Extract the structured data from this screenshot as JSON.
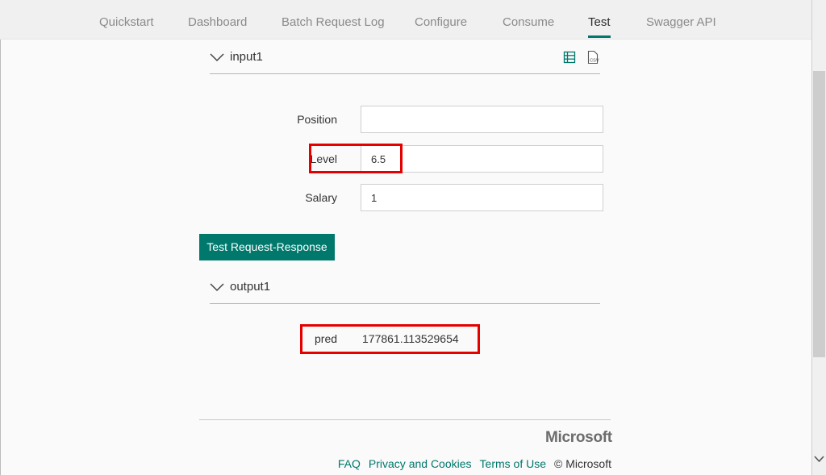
{
  "nav": {
    "tabs": [
      {
        "label": "Quickstart",
        "active": false
      },
      {
        "label": "Dashboard",
        "active": false
      },
      {
        "label": "Batch Request Log",
        "active": false
      },
      {
        "label": "Configure",
        "active": false
      },
      {
        "label": "Consume",
        "active": false
      },
      {
        "label": "Test",
        "active": true
      },
      {
        "label": "Swagger API",
        "active": false
      }
    ]
  },
  "input_section": {
    "title": "input1",
    "icons": [
      "table-view-icon",
      "csv-file-icon"
    ],
    "fields": [
      {
        "label": "Position",
        "value": ""
      },
      {
        "label": "Level",
        "value": "6.5"
      },
      {
        "label": "Salary",
        "value": "1"
      }
    ]
  },
  "test_button": {
    "label": "Test Request-Response"
  },
  "output_section": {
    "title": "output1",
    "result_label": "pred",
    "result_value": "177861.113529654"
  },
  "footer": {
    "brand": "Microsoft",
    "links": [
      "FAQ",
      "Privacy and Cookies",
      "Terms of Use"
    ],
    "copyright": "© Microsoft"
  },
  "colors": {
    "accent": "#00786c",
    "highlight": "#e50000"
  }
}
